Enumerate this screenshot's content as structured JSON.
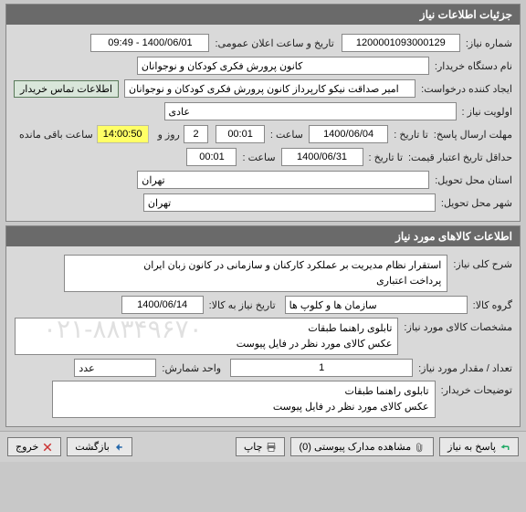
{
  "section_need": {
    "header": "جزئیات اطلاعات نیاز",
    "labels": {
      "need_number": "شماره نیاز:",
      "public_announce": "تاریخ و ساعت اعلان عمومی:",
      "buyer_org": "نام دستگاه خریدار:",
      "request_creator": "ایجاد کننده درخواست:",
      "contact_btn": "اطلاعات تماس خریدار",
      "priority": "اولویت نیاز :",
      "reply_deadline": "مهلت ارسال پاسخ:",
      "until_date": "تا تاریخ :",
      "hour": "ساعت :",
      "remaining_days_prefix": "",
      "remaining_days_suffix": "روز و",
      "remaining_hours_suffix": "ساعت باقی مانده",
      "price_validity": "حداقل تاریخ اعتبار قیمت:",
      "delivery_province": "استان محل تحویل:",
      "delivery_city": "شهر محل تحویل:"
    },
    "values": {
      "need_number": "1200001093000129",
      "public_announce": "1400/06/01 - 09:49",
      "buyer_org": "کانون پرورش فکری کودکان و نوجوانان",
      "request_creator": "امیر صداقت نیکو کارپرداز کانون پرورش فکری کودکان و نوجوانان",
      "priority": "عادی",
      "reply_date": "1400/06/04",
      "reply_hour": "00:01",
      "remaining_days": "2",
      "remaining_countdown": "14:00:50",
      "price_validity_date": "1400/06/31",
      "price_validity_hour": "00:01",
      "delivery_province": "تهران",
      "delivery_city": "تهران"
    }
  },
  "section_goods": {
    "header": "اطلاعات کالاهای مورد نیاز",
    "labels": {
      "general_desc": "شرح کلی نیاز:",
      "goods_group": "گروه کالا:",
      "need_date": "تاریخ نیاز به کالا:",
      "goods_spec": "مشخصات کالای مورد نیاز:",
      "quantity": "تعداد / مقدار مورد نیاز:",
      "unit": "واحد شمارش:",
      "buyer_notes": "توضیحات خریدار:"
    },
    "values": {
      "general_desc": "استقرار نظام مدیریت بر عملکرد کارکنان  و سازمانی در کانون زبان ایران\nپرداخت اعتباری",
      "goods_group": "سازمان ها و کلوپ ها",
      "need_date": "1400/06/14",
      "goods_spec": "تابلوی راهنما طبقات\nعکس کالای مورد نظر در فایل پیوست",
      "quantity": "1",
      "unit": "عدد",
      "buyer_notes": "تابلوی راهنما طبقات\nعکس کالای مورد نظر در فایل پیوست"
    }
  },
  "footer": {
    "respond": "پاسخ به نیاز",
    "attachments": "مشاهده مدارک پیوستی (0)",
    "print": "چاپ",
    "back": "بازگشت",
    "exit": "خروج"
  },
  "watermark": "۰۲۱-۸۸۳۴۹۶۷۰"
}
